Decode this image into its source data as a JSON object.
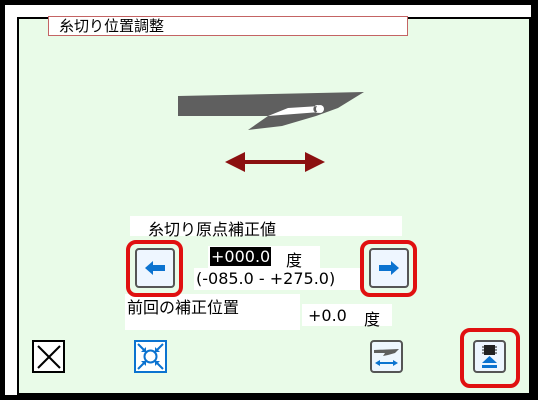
{
  "window": {
    "title": "糸切り位置調整"
  },
  "controls": {
    "origin_label": "糸切り原点補正値",
    "value_highlight": "+000.0",
    "value_unit": "度",
    "range_text": "(-085.0 - +275.0)",
    "prev_label": "前回の補正位置",
    "prev_value": "+0.0",
    "prev_unit": "度"
  },
  "icons": {
    "left_button": "arrow-left-icon",
    "right_button": "arrow-right-icon",
    "close": "close-x-icon",
    "zoom": "zoom-arrows-icon",
    "blade_move": "blade-move-icon",
    "confirm": "upload-arrow-icon"
  },
  "colors": {
    "panel_bg": "#e9fbe8",
    "highlight_red": "#e01010",
    "arrow_maroon": "#8b1010",
    "blade_gray": "#5f5f5f",
    "button_blue": "#0b73d0"
  }
}
